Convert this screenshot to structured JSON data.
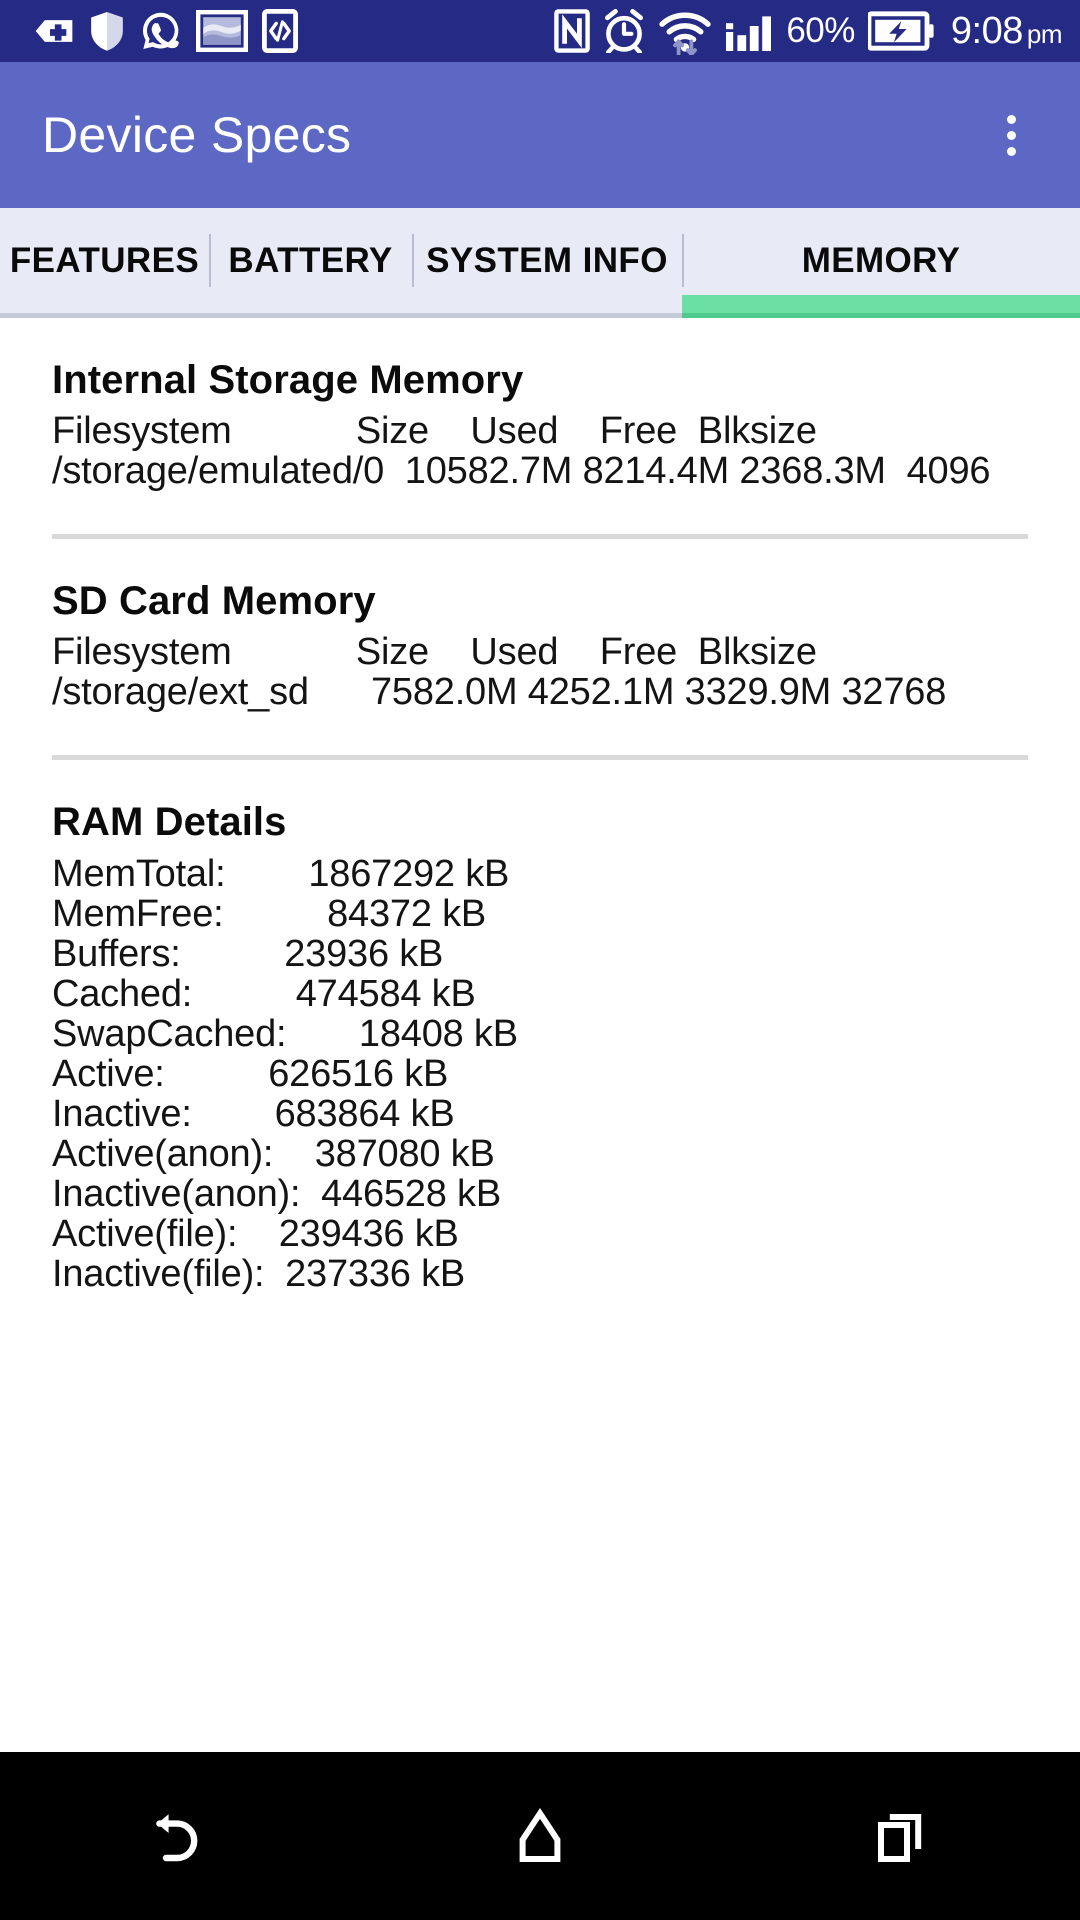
{
  "status_bar": {
    "left_icons": [
      {
        "name": "medical-plus-icon",
        "label": "medical"
      },
      {
        "name": "shield-icon",
        "label": "shield"
      },
      {
        "name": "whatsapp-icon",
        "label": "whatsapp"
      },
      {
        "name": "gallery-image-icon",
        "label": "gallery"
      },
      {
        "name": "code-brackets-icon",
        "label": "code"
      }
    ],
    "right_icons": [
      {
        "name": "nfc-icon",
        "label": "nfc"
      },
      {
        "name": "alarm-clock-icon",
        "label": "alarm"
      },
      {
        "name": "wifi-data-icon",
        "label": "wifi"
      },
      {
        "name": "signal-bars-icon",
        "label": "signal"
      }
    ],
    "battery_percent": "60%",
    "battery_state": "charging",
    "time": "9:08",
    "ampm": "pm",
    "background": "#252a85"
  },
  "toolbar": {
    "title": "Device Specs",
    "overflow_label": "More options",
    "background": "#5c68c4"
  },
  "tabs": {
    "items": [
      {
        "label": "FEATURES",
        "selected": false
      },
      {
        "label": "BATTERY",
        "selected": false
      },
      {
        "label": "SYSTEM INFO",
        "selected": false
      },
      {
        "label": "MEMORY",
        "selected": true
      }
    ],
    "indicator_color": "#6ce0a4",
    "background": "#e8eaf6"
  },
  "main": {
    "sections": [
      {
        "id": "internal-storage",
        "title": "Internal Storage Memory",
        "columns": [
          "Filesystem",
          "Size",
          "Used",
          "Free",
          "Blksize"
        ],
        "header_line": "Filesystem            Size    Used    Free  Blksize",
        "rows": [
          {
            "filesystem": "/storage/emulated/0",
            "size": "10582.7M",
            "used": "8214.4M",
            "free": "2368.3M",
            "blksize": "4096"
          }
        ],
        "row_line": "/storage/emulated/0  10582.7M 8214.4M 2368.3M  4096"
      },
      {
        "id": "sd-card",
        "title": "SD Card Memory",
        "columns": [
          "Filesystem",
          "Size",
          "Used",
          "Free",
          "Blksize"
        ],
        "header_line": "Filesystem            Size    Used    Free  Blksize",
        "rows": [
          {
            "filesystem": "/storage/ext_sd",
            "size": "7582.0M",
            "used": "4252.1M",
            "free": "3329.9M",
            "blksize": "32768"
          }
        ],
        "row_line": "/storage/ext_sd      7582.0M 4252.1M 3329.9M 32768"
      },
      {
        "id": "ram-details",
        "title": "RAM Details",
        "entries": [
          {
            "key": "MemTotal:",
            "value": "1867292 kB"
          },
          {
            "key": "MemFree:",
            "value": "84372 kB"
          },
          {
            "key": "Buffers:",
            "value": "23936 kB"
          },
          {
            "key": "Cached:",
            "value": "474584 kB"
          },
          {
            "key": "SwapCached:",
            "value": "18408 kB"
          },
          {
            "key": "Active:",
            "value": "626516 kB"
          },
          {
            "key": "Inactive:",
            "value": "683864 kB"
          },
          {
            "key": "Active(anon):",
            "value": "387080 kB"
          },
          {
            "key": "Inactive(anon):",
            "value": "446528 kB"
          },
          {
            "key": "Active(file):",
            "value": "239436 kB"
          },
          {
            "key": "Inactive(file):",
            "value": "237336 kB"
          }
        ],
        "entries_block": "MemTotal:        1867292 kB\nMemFree:          84372 kB\nBuffers:          23936 kB\nCached:          474584 kB\nSwapCached:       18408 kB\nActive:          626516 kB\nInactive:        683864 kB\nActive(anon):    387080 kB\nInactive(anon):  446528 kB\nActive(file):    239436 kB\nInactive(file):  237336 kB"
      }
    ]
  },
  "navbar": {
    "buttons": [
      {
        "name": "back-button",
        "label": "Back"
      },
      {
        "name": "home-button",
        "label": "Home"
      },
      {
        "name": "recents-button",
        "label": "Recent apps"
      }
    ],
    "background": "#000000"
  }
}
